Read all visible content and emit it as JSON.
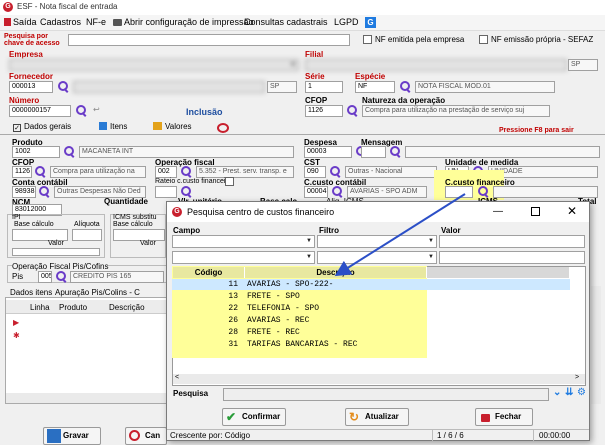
{
  "window": {
    "title": "ESF - Nota fiscal de entrada"
  },
  "menu": [
    "Saída",
    "Cadastros",
    "NF-e",
    "Abrir configuração de impressão",
    "Consultas cadastrais",
    "LGPD"
  ],
  "top": {
    "search_label_1": "Pesquisa por",
    "search_label_2": "chave de acesso",
    "nf_emitida": "NF emitida pela empresa",
    "nf_emissao": "NF emissão própria - SEFAZ",
    "empresa_label": "Empresa",
    "filial_label": "Filial",
    "filial_state": "SP",
    "fornecedor_label": "Fornecedor",
    "fornecedor_code": "000013",
    "fornecedor_state": "SP",
    "serie_label": "Série",
    "serie_value": "1",
    "especie_label": "Espécie",
    "especie_code": "NF",
    "especie_desc": "NOTA FISCAL MOD.01",
    "numero_label": "Número",
    "numero_value": "0000000157",
    "inclusao": "Inclusão",
    "cfop_label": "CFOP",
    "cfop_value": "1126",
    "natureza_label": "Natureza da operação",
    "natureza_value": "Compra para utilização na prestação de serviço suj"
  },
  "tabs": [
    "Dados gerais",
    "Itens",
    "Valores"
  ],
  "hint": "Pressione F8 para sair",
  "items_form": {
    "produto_label": "Produto",
    "produto_code": "1002",
    "produto_desc": "MACANETA INT",
    "despesa_label": "Despesa",
    "despesa_code": "00003",
    "mensagem_label": "Mensagem",
    "cfop_label": "CFOP",
    "cfop_code": "1126",
    "cfop_desc": "Compra para utilização na",
    "opfiscal_label": "Operação fiscal",
    "opfiscal_code": "002",
    "opfiscal_desc": "5.352 - Prest. serv. transp. e",
    "cst_label": "CST",
    "cst_code": "090",
    "cst_desc": "Outras - Nacional",
    "unidade_label": "Unidade de medida",
    "unidade_code": "UN",
    "unidade_desc": "UNIDADE",
    "conta_label": "Conta contábil",
    "conta_code": "98938",
    "conta_desc": "Outras Despesas Não Ded",
    "rateio_label": "Rateio c.custo financeiro",
    "ccusto_contabil_label": "C.custo contábil",
    "ccusto_contabil_code": "00004",
    "ccusto_contabil_desc": "AVARIAS - SPO ADM",
    "ccusto_fin_label": "C.custo financeiro",
    "ncm_label": "NCM",
    "ncm_value": "83012000",
    "quantidade_label": "Quantidade",
    "vlr_unit_label": "Vlr. unitário",
    "base_calc_label": "Base calc.",
    "aliq_icms_label": "Aliq. ICMS",
    "icms_label": "ICMS",
    "total_label": "Total",
    "ipi_label": "IPI",
    "ipi_base": "Base cálculo",
    "ipi_aliq": "Alíquota",
    "icms_subst_label": "ICMS substitu",
    "icms_subst_base": "Base cálculo",
    "valor_1": "Valor",
    "valor_2": "Valor",
    "pis_section": "Operação Fiscal Pis/Cofins",
    "pis_label": "Pis",
    "pis_code": "005",
    "pis_desc": "CREDITO PIS 165",
    "bottom_tab_1": "Dados itens",
    "bottom_tab_2": "Apuração Pis/Colins - C",
    "col_linha": "Linha",
    "col_produto": "Produto",
    "col_descricao": "Descrição"
  },
  "bottom": {
    "gravar": "Gravar",
    "cancelar": "Can"
  },
  "dialog": {
    "title": "Pesquisa centro de custos financeiro",
    "campo_label": "Campo",
    "filtro_label": "Filtro",
    "valor_label": "Valor",
    "col_codigo": "Código",
    "col_descricao": "Descrição",
    "rows": [
      {
        "code": "11",
        "desc": "AVARIAS - SPO-222-"
      },
      {
        "code": "13",
        "desc": "FRETE - SPO"
      },
      {
        "code": "22",
        "desc": "TELEFONIA - SPO"
      },
      {
        "code": "26",
        "desc": "AVARIAS - REC"
      },
      {
        "code": "28",
        "desc": "FRETE - REC"
      },
      {
        "code": "31",
        "desc": "TARIFAS BANCARIAS - REC"
      }
    ],
    "pesquisa_label": "Pesquisa",
    "confirmar": "Confirmar",
    "atualizar": "Atualizar",
    "fechar": "Fechar"
  },
  "status": {
    "order": "Crescente por: Código",
    "count": "1 / 6 / 6",
    "time": "00:00:00"
  },
  "colors": {
    "accent": "#c81f2d",
    "highlight": "#ffff99",
    "selection": "#cde8ff",
    "link": "#1f7be0"
  }
}
